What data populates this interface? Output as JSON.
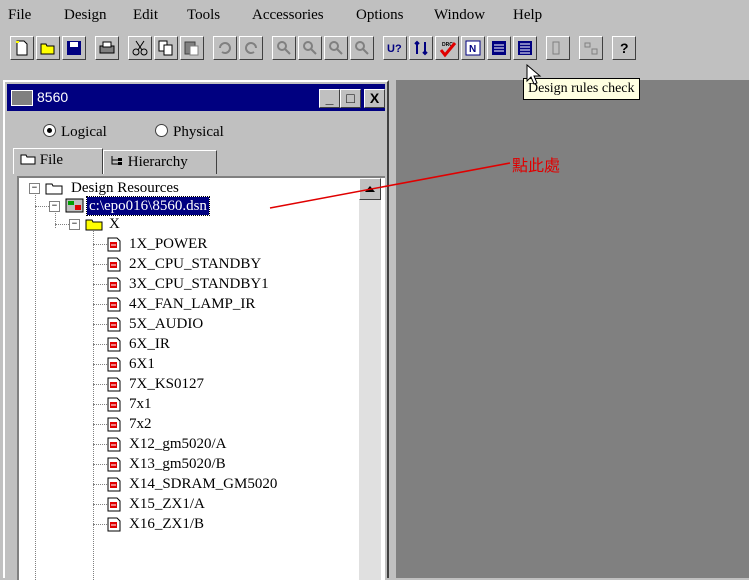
{
  "menu": {
    "items": [
      {
        "label": "File"
      },
      {
        "label": "Design"
      },
      {
        "label": "Edit"
      },
      {
        "label": "Tools"
      },
      {
        "label": "Accessories"
      },
      {
        "label": "Options"
      },
      {
        "label": "Window"
      },
      {
        "label": "Help"
      }
    ]
  },
  "toolbar": {
    "buttons": [
      "new-icon",
      "open-icon",
      "save-icon",
      "print-icon",
      "cut-icon",
      "copy-icon",
      "paste-icon",
      "undo-icon",
      "redo-icon",
      "find-icon",
      "find-next-icon",
      "zoom-icon",
      "browse-icon",
      "annotate-icon",
      "update-field-icon",
      "drc-icon",
      "netlist-icon",
      "bom-icon",
      "cross-ref-icon",
      "export-icon",
      "import-icon",
      "help-icon"
    ],
    "drc_badge": "DRC",
    "u_label": "U?",
    "tooltip": "Design rules check"
  },
  "project_window": {
    "title": "8560",
    "min_label": "_",
    "max_label": "□",
    "close_label": "X",
    "radio_logical": "Logical",
    "radio_physical": "Physical",
    "logical_selected": true,
    "tab_file": "File",
    "tab_hierarchy": "Hierarchy"
  },
  "tree": {
    "root": "Design Resources",
    "design": "c:\\epo016\\8560.dsn",
    "folder": "X",
    "pages": [
      "1X_POWER",
      "2X_CPU_STANDBY",
      "3X_CPU_STANDBY1",
      "4X_FAN_LAMP_IR",
      "5X_AUDIO",
      "6X_IR",
      "6X1",
      "7X_KS0127",
      "7x1",
      "7x2",
      "X12_gm5020/A",
      "X13_gm5020/B",
      "X14_SDRAM_GM5020",
      "X15_ZX1/A",
      "X16_ZX1/B"
    ]
  },
  "annotation": {
    "text": "點此處",
    "color": "#e00000"
  },
  "colors": {
    "title_bar": "#000080",
    "workspace": "#808080",
    "tooltip_bg": "#ffffe1"
  }
}
